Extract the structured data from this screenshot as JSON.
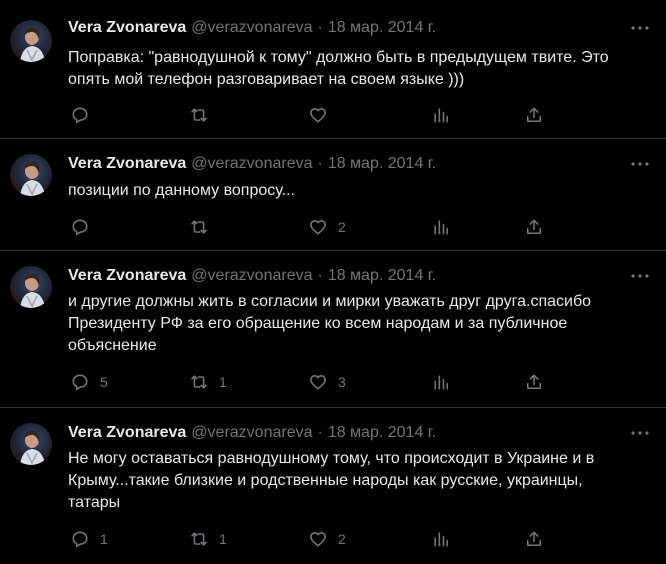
{
  "tweets": [
    {
      "author_name": "Vera Zvonareva",
      "handle": "@verazvonareva",
      "separator": "·",
      "date": "18 мар. 2014 г.",
      "text": "Поправка: \"равнодушной к тому\" должно быть в предыдущем твите. Это опять мой телефон разговаривает на своем языке )))",
      "replies": "",
      "retweets": "",
      "likes": "",
      "views": ""
    },
    {
      "author_name": "Vera Zvonareva",
      "handle": "@verazvonareva",
      "separator": "·",
      "date": "18 мар. 2014 г.",
      "text": "позиции по данному вопросу...",
      "replies": "",
      "retweets": "",
      "likes": "2",
      "views": ""
    },
    {
      "author_name": "Vera Zvonareva",
      "handle": "@verazvonareva",
      "separator": "·",
      "date": "18 мар. 2014 г.",
      "text": "и другие должны жить в согласии и мирки уважать друг друга.спасибо Президенту РФ за его обращение ко всем народам и за публичное объяснение",
      "replies": "5",
      "retweets": "1",
      "likes": "3",
      "views": ""
    },
    {
      "author_name": "Vera Zvonareva",
      "handle": "@verazvonareva",
      "separator": "·",
      "date": "18 мар. 2014 г.",
      "text": "Не могу оставаться равнодушному тому, что происходит в Украине и в Крыму...такие близкие и родственные народы как русские, украинцы, татары",
      "replies": "1",
      "retweets": "1",
      "likes": "2",
      "views": ""
    }
  ],
  "icons": {
    "more": "more-dots-icon",
    "reply": "reply-bubble-icon",
    "retweet": "retweet-icon",
    "like": "heart-icon",
    "views": "bar-chart-icon",
    "share": "share-upload-icon"
  },
  "colors": {
    "background": "#000000",
    "text": "#e7e9ea",
    "muted": "#71767b",
    "divider": "#2f3336"
  }
}
